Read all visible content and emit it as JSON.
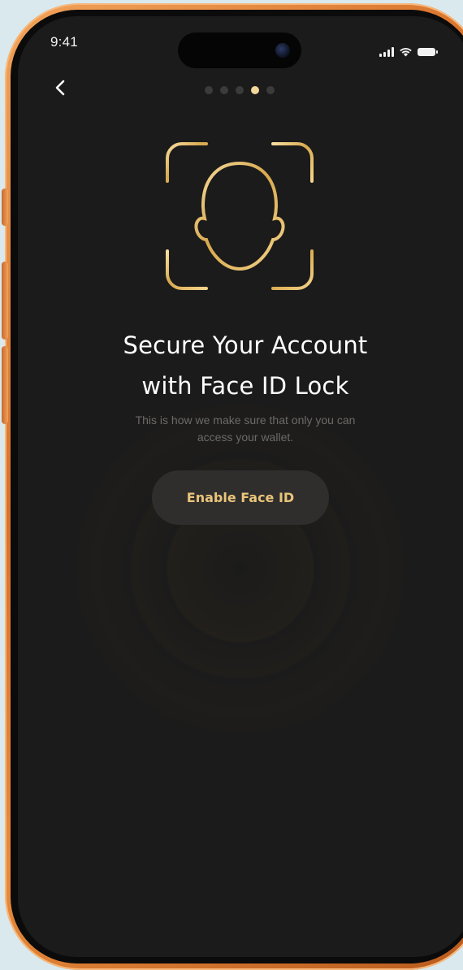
{
  "status_bar": {
    "time": "9:41",
    "icons": [
      "signal-icon",
      "wifi-icon",
      "battery-icon"
    ]
  },
  "navigation": {
    "back_icon": "chevron-left-icon",
    "pager": {
      "total": 5,
      "active_index": 3
    }
  },
  "illustration": {
    "icon": "face-id-icon"
  },
  "content": {
    "title_line1": "Secure Your Account",
    "title_line2": "with Face ID Lock",
    "subtitle_line1": "This is how we make sure that only you can",
    "subtitle_line2": "access your wallet.",
    "button_label": "Enable Face ID"
  },
  "colors": {
    "background": "#1c1b1b",
    "accent_gold": "#e9c47a",
    "button_bg": "#2f2e2d",
    "frame_orange": "#e88a3c"
  }
}
